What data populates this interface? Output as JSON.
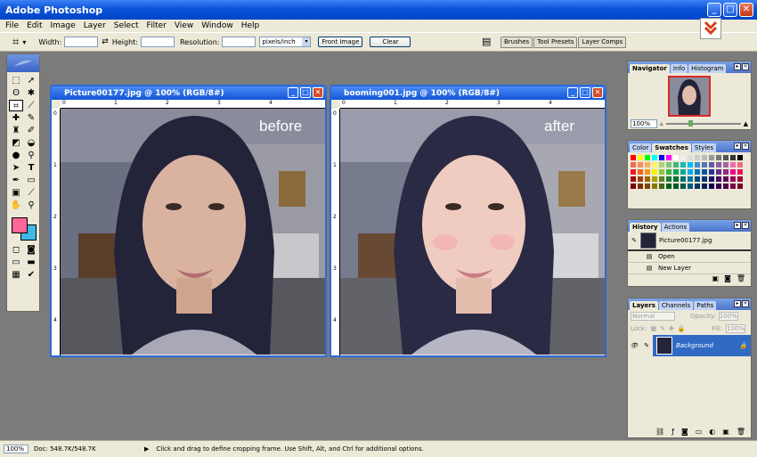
{
  "app": {
    "title": "Adobe Photoshop"
  },
  "menu": [
    "File",
    "Edit",
    "Image",
    "Layer",
    "Select",
    "Filter",
    "View",
    "Window",
    "Help"
  ],
  "options": {
    "width_label": "Width:",
    "height_label": "Height:",
    "resolution_label": "Resolution:",
    "units": "pixels/inch",
    "front_image": "Front Image",
    "clear": "Clear"
  },
  "wells": [
    "Brushes",
    "Tool Presets",
    "Layer Comps"
  ],
  "doc1": {
    "title": "Picture00177.jpg @ 100% (RGB/8#)",
    "overlay": "before"
  },
  "doc2": {
    "title": "booming001.jpg @ 100% (RGB/8#)",
    "overlay": "after"
  },
  "ruler_labels": [
    "0",
    "1",
    "2",
    "3",
    "4"
  ],
  "navigator": {
    "tabs": [
      "Navigator",
      "Info",
      "Histogram"
    ],
    "zoom": "100%"
  },
  "color_panel": {
    "tabs": [
      "Color",
      "Swatches",
      "Styles"
    ]
  },
  "history": {
    "tabs": [
      "History",
      "Actions"
    ],
    "snapshot": "Picture00177.jpg",
    "steps": [
      "Open",
      "New Layer"
    ]
  },
  "layers": {
    "tabs": [
      "Layers",
      "Channels",
      "Paths"
    ],
    "blend": "Normal",
    "opacity_label": "Opacity:",
    "opacity": "100%",
    "lock_label": "Lock:",
    "fill_label": "Fill:",
    "fill": "100%",
    "layer_name": "Background"
  },
  "status": {
    "zoom": "100%",
    "doc": "Doc: 548.7K/548.7K",
    "message": "Click and drag to define cropping frame. Use Shift, Alt, and Ctrl for additional options."
  },
  "colors": {
    "foreground": "#ff6699",
    "background": "#3fb9e8",
    "title_blue": "#0b53d8"
  }
}
